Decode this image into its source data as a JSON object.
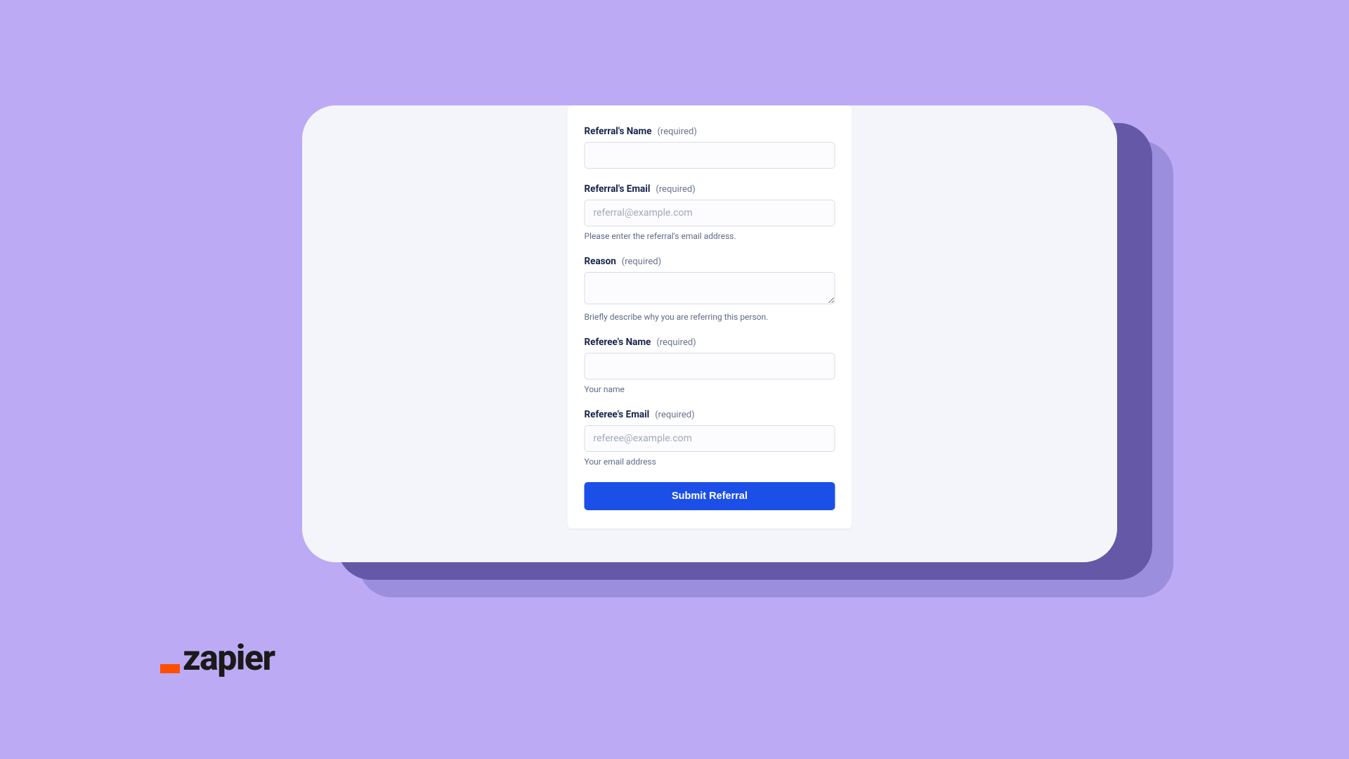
{
  "form": {
    "fields": {
      "referral_name": {
        "label": "Referral's Name",
        "required_text": "(required)",
        "placeholder": "",
        "value": "",
        "help": ""
      },
      "referral_email": {
        "label": "Referral's Email",
        "required_text": "(required)",
        "placeholder": "referral@example.com",
        "value": "",
        "help": "Please enter the referral's email address."
      },
      "reason": {
        "label": "Reason",
        "required_text": "(required)",
        "placeholder": "",
        "value": "",
        "help": "Briefly describe why you are referring this person."
      },
      "referee_name": {
        "label": "Referee's Name",
        "required_text": "(required)",
        "placeholder": "",
        "value": "",
        "help": "Your name"
      },
      "referee_email": {
        "label": "Referee's Email",
        "required_text": "(required)",
        "placeholder": "referee@example.com",
        "value": "",
        "help": "Your email address"
      }
    },
    "submit_label": "Submit Referral"
  },
  "logo": {
    "text": "zapier"
  }
}
